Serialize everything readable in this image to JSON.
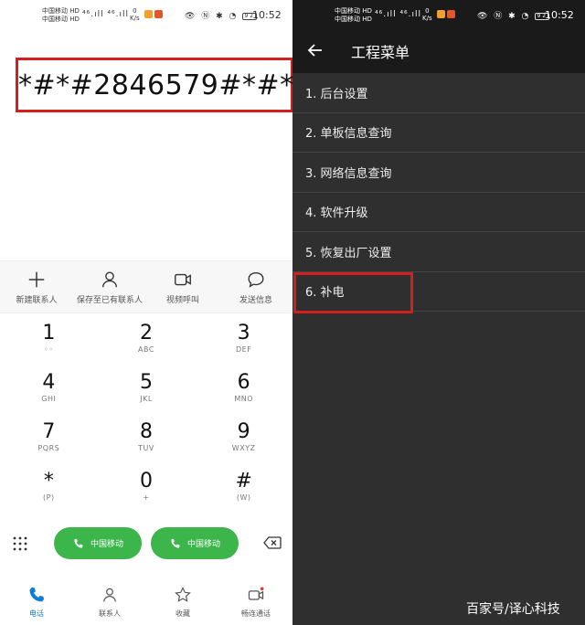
{
  "left": {
    "status": {
      "carrier1": "中国移动",
      "carrier2": "中国移动",
      "hd": "HD",
      "signal": "⁴⁶.ıll ⁴⁶.ıll",
      "speed_value": "0",
      "speed_unit": "K/s",
      "battery": "92",
      "time": "10:52"
    },
    "dialed_number": "*#*#2846579#*#*",
    "actions": [
      {
        "label": "新建联系人",
        "icon": "plus-icon"
      },
      {
        "label": "保存至已有联系人",
        "icon": "person-icon"
      },
      {
        "label": "视频呼叫",
        "icon": "video-camera-icon"
      },
      {
        "label": "发送信息",
        "icon": "message-bubble-icon"
      }
    ],
    "keys": [
      [
        {
          "digit": "1",
          "letters": ""
        },
        {
          "digit": "2",
          "letters": "ABC"
        },
        {
          "digit": "3",
          "letters": "DEF"
        }
      ],
      [
        {
          "digit": "4",
          "letters": "GHI"
        },
        {
          "digit": "5",
          "letters": "JKL"
        },
        {
          "digit": "6",
          "letters": "MNO"
        }
      ],
      [
        {
          "digit": "7",
          "letters": "PQRS"
        },
        {
          "digit": "8",
          "letters": "TUV"
        },
        {
          "digit": "9",
          "letters": "WXYZ"
        }
      ],
      [
        {
          "digit": "*",
          "letters": "(P)"
        },
        {
          "digit": "0",
          "letters": "+"
        },
        {
          "digit": "#",
          "letters": "(W)"
        }
      ]
    ],
    "call_buttons": [
      {
        "label": "中国移动",
        "sim": "1"
      },
      {
        "label": "中国移动",
        "sim": "2"
      }
    ],
    "nav": [
      {
        "label": "电话",
        "icon": "phone-icon",
        "active": true
      },
      {
        "label": "联系人",
        "icon": "contacts-icon",
        "active": false
      },
      {
        "label": "收藏",
        "icon": "star-icon",
        "active": false
      },
      {
        "label": "畅连通话",
        "icon": "video-call-icon",
        "active": false
      }
    ],
    "colors": {
      "accent_green": "#3cb54b",
      "highlight_red": "#d41f1f",
      "nav_active": "#0a7fd6"
    }
  },
  "right": {
    "title": "工程菜单",
    "menu": [
      "1. 后台设置",
      "2. 单板信息查询",
      "3. 网络信息查询",
      "4. 软件升级",
      "5. 恢复出厂设置",
      "6. 补电"
    ],
    "colors": {
      "background": "#2f2f2f",
      "bar": "#1a1a1a"
    }
  },
  "watermark": "百家号/译心科技"
}
